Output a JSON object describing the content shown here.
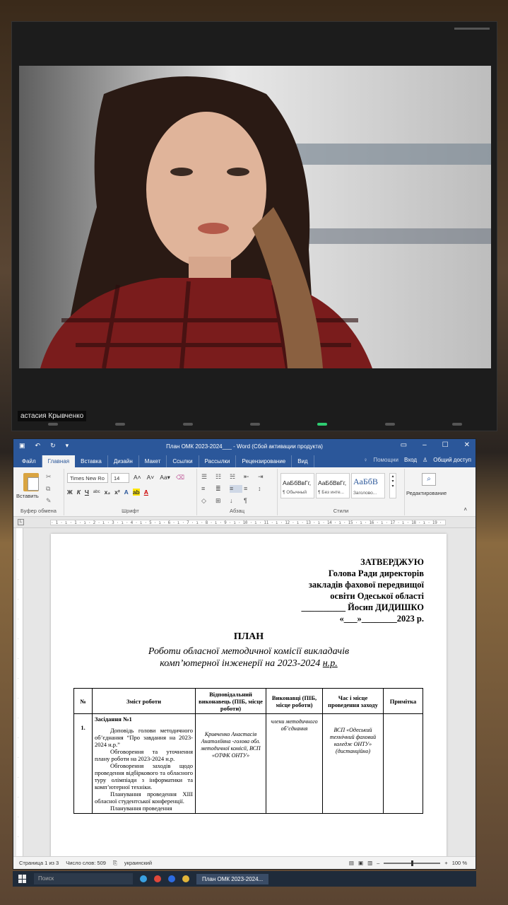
{
  "video_call": {
    "participant_name": "астасия Крывченко"
  },
  "word": {
    "title": "План ОМК 2023-2024___ - Word (Сбой активации продукта)",
    "tabs": [
      "Файл",
      "Главная",
      "Вставка",
      "Дизайн",
      "Макет",
      "Ссылки",
      "Рассылки",
      "Рецензирование",
      "Вид"
    ],
    "active_tab": "Главная",
    "help": "Помощни",
    "login": "Вход",
    "share": "Общий доступ",
    "clipboard": {
      "paste": "Вставить",
      "group": "Буфер обмена"
    },
    "font": {
      "name": "Times New Ro",
      "size": "14",
      "group": "Шрифт"
    },
    "paragraph": {
      "group": "Абзац"
    },
    "styles": {
      "group": "Стили",
      "items": [
        {
          "sample": "АаБбВвГг,",
          "name": "¶ Обычный"
        },
        {
          "sample": "АаБбВвГг,",
          "name": "¶ Без инте..."
        },
        {
          "sample": "АаБбВ",
          "name": "Заголово..."
        }
      ]
    },
    "editing": {
      "label": "Редактирование"
    },
    "ruler_text": "· 1 · ı · 1 · ı · 2 · ı · 3 · ı · 4 · ı · 5 · ı · 6 · ı · 7 · ı · 8 · ı · 9 · ı · 10 · ı · 11 · ı · 12 · ı · 13 · ı · 14 · ı · 15 · ı · 16 · ı · 17 · ı · 18 · ı · 19 ·",
    "document": {
      "approve": [
        "ЗАТВЕРДЖУЮ",
        "Голова Ради директорів",
        "закладів фахової передвищої",
        "освіти Одеської області",
        "__________ Йосип ДИДИШКО",
        "«___»________2023 р."
      ],
      "title": "ПЛАН",
      "subtitle_line1": "Роботи обласної методичної комісії викладачів",
      "subtitle_line2_a": "комп’ютерної інженерії на 2023-2024 ",
      "subtitle_line2_b": "н.р.",
      "table": {
        "headers": [
          "№",
          "Зміст роботи",
          "Відповідальний виконавець (ПІБ, місце роботи)",
          "Виконавці (ПІБ, місце роботи)",
          "Час і місце проведення заходу",
          "Примітка"
        ],
        "row1": {
          "num": "1.",
          "heading": "Засідання №1",
          "p1": "Доповідь голови методичного об’єднання “Про завдання на 2023-2024 н.р.”",
          "p2": "Обговорення та уточнення плану роботи на 2023-2024 н.р.",
          "p3": "Обговорення заходів щодо проведення відбіркового та обласного туру олімпіади з інформатики та комп’ютерної техніки.",
          "p4": "Планування проведення XIII обласної студентської конференції.",
          "p5": "Планування проведення",
          "responsible": "Кривченко Анастасія Анатоліївна -голова обл. методичної комісії, ВСП «ОТФК ОНТУ»",
          "executors": "члени методичного об’єднання",
          "time_place": "ВСП «Одеський технічний фаховий коледж ОНТУ» (дистанційно)",
          "note": ""
        }
      }
    },
    "status": {
      "page": "Страница 1 из 3",
      "words": "Число слов: 509",
      "language": "украинский",
      "zoom": "100 %"
    }
  },
  "taskbar": {
    "search": "Поиск",
    "word_task": "План ОМК 2023-2024..."
  }
}
